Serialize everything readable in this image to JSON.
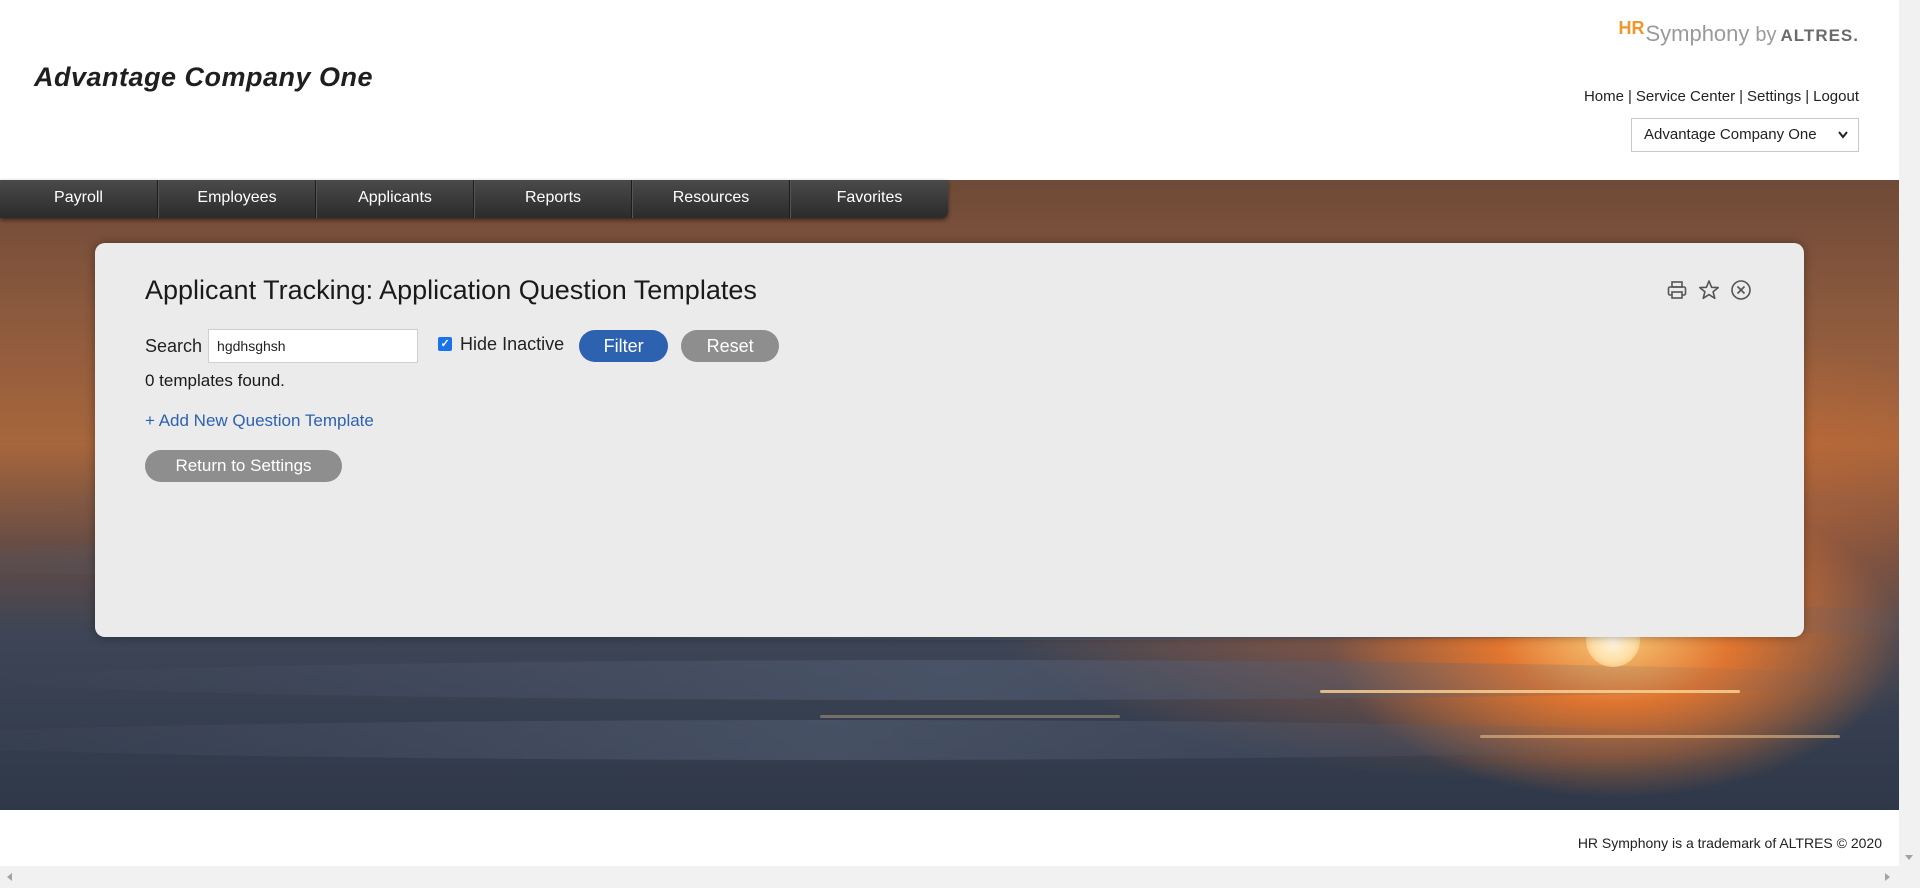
{
  "header": {
    "company_title": "Advantage Company One",
    "brand": {
      "hr": "HR",
      "symphony": "Symphony",
      "by": "by",
      "altres": "ALTRES."
    },
    "links": [
      "Home",
      "Service Center",
      "Settings",
      "Logout"
    ],
    "link_separator": "|",
    "company_select": {
      "value": "Advantage Company One"
    }
  },
  "nav": {
    "items": [
      "Payroll",
      "Employees",
      "Applicants",
      "Reports",
      "Resources",
      "Favorites"
    ]
  },
  "panel": {
    "title": "Applicant Tracking: Application Question Templates",
    "icons": [
      "print-icon",
      "star-icon",
      "close-circle-icon"
    ],
    "search": {
      "label": "Search",
      "value": "hgdhsghsh"
    },
    "hide_inactive": {
      "label": "Hide Inactive",
      "checked": true
    },
    "filter_button": "Filter",
    "reset_button": "Reset",
    "results_text": "0 templates found.",
    "add_link": "+ Add New Question Template",
    "return_button": "Return to Settings"
  },
  "footer": {
    "text": "HR Symphony is a trademark of ALTRES © 2020"
  },
  "colors": {
    "accent": "#2d62b0",
    "nav_bg": "#333333",
    "panel_bg": "#ebebeb",
    "brand_orange": "#f0962b"
  }
}
